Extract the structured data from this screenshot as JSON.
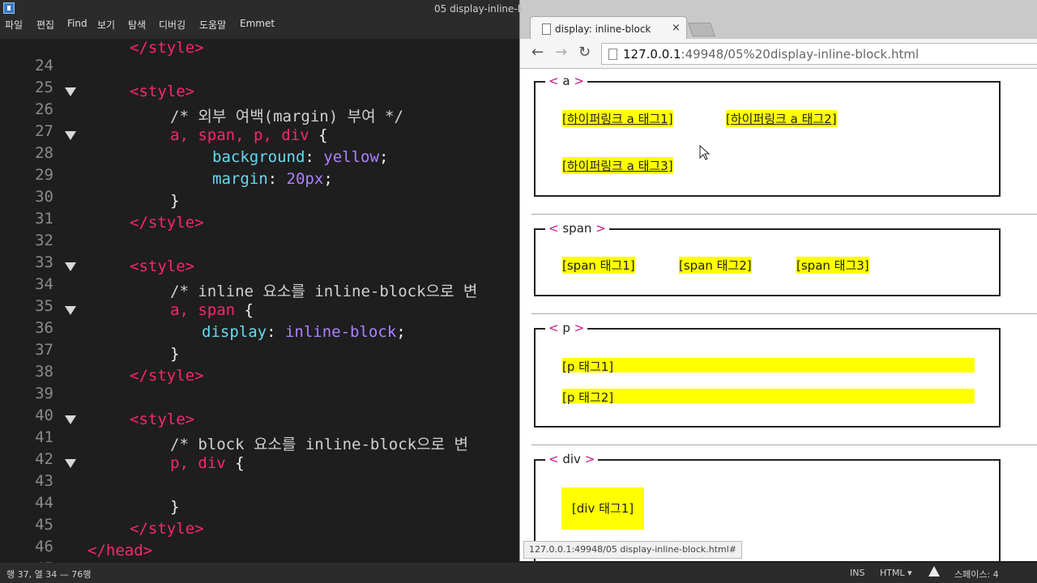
{
  "editor": {
    "menu": [
      "파일",
      "편집",
      "Find",
      "보기",
      "탐색",
      "디버깅",
      "도움말",
      "Emmet"
    ],
    "title": "05 display-inline-bl",
    "lines": [
      {
        "n": "24",
        "fold": false
      },
      {
        "n": "25",
        "fold": false
      },
      {
        "n": "26",
        "fold": true
      },
      {
        "n": "27",
        "fold": false
      },
      {
        "n": "28",
        "fold": true
      },
      {
        "n": "29",
        "fold": false
      },
      {
        "n": "30",
        "fold": false
      },
      {
        "n": "31",
        "fold": false
      },
      {
        "n": "32",
        "fold": false
      },
      {
        "n": "33",
        "fold": false
      },
      {
        "n": "34",
        "fold": true
      },
      {
        "n": "35",
        "fold": false
      },
      {
        "n": "36",
        "fold": true
      },
      {
        "n": "37",
        "fold": false
      },
      {
        "n": "38",
        "fold": false
      },
      {
        "n": "39",
        "fold": false
      },
      {
        "n": "40",
        "fold": false
      },
      {
        "n": "41",
        "fold": true
      },
      {
        "n": "42",
        "fold": false
      },
      {
        "n": "43",
        "fold": true
      },
      {
        "n": "44",
        "fold": false
      },
      {
        "n": "45",
        "fold": false
      },
      {
        "n": "46",
        "fold": false
      },
      {
        "n": "47",
        "fold": false
      }
    ],
    "code": {
      "l24": "</style>",
      "l26": "<style>",
      "l27": "/* 외부 여백(margin) 부여 */",
      "l28_sel": "a, span, p, div",
      "l28_brace": " {",
      "l29_prop": "background",
      "l29_val": "yellow",
      "l30_prop": "margin",
      "l30_val": "20px",
      "l31": "}",
      "l32": "</style>",
      "l34": "<style>",
      "l35": "/* inline 요소를 inline-block으로 변",
      "l36_sel": "a, span",
      "l36_brace": " {",
      "l37_prop": "display",
      "l37_val": "inline-block",
      "l38": "}",
      "l39": "</style>",
      "l41": "<style>",
      "l42": "/* block 요소를 inline-block으로 변",
      "l43_sel": "p, div",
      "l43_brace": " {",
      "l45": "}",
      "l46": "</style>",
      "l47": "</head>",
      "colon": ":",
      "semi": ";"
    },
    "status": {
      "position": "행 37, 열 34 — 76행",
      "ins": "INS",
      "mode": "HTML ▾",
      "spaces": "스페이스: 4"
    }
  },
  "browser": {
    "tab_title": "display: inline-block",
    "tab_close": "×",
    "url_host": "127.0.0.1",
    "url_rest": ":49948/05%20display-inline-block.html",
    "status_url": "127.0.0.1:49948/05 display-inline-block.html#",
    "sections": {
      "a": {
        "legend": "a",
        "items": [
          "[하이퍼링크 a 태그1]",
          "[하이퍼링크 a 태그2]",
          "[하이퍼링크 a 태그3]"
        ]
      },
      "span": {
        "legend": "span",
        "items": [
          "[span 태그1]",
          "[span 태그2]",
          "[span 태그3]"
        ]
      },
      "p": {
        "legend": "p",
        "items": [
          "[p 태그1]",
          "[p 태그2]"
        ]
      },
      "div": {
        "legend": "div",
        "items": [
          "[div 태그1]"
        ]
      }
    },
    "legend_open": "<",
    "legend_close": ">"
  },
  "colors": {
    "highlight": "#ffff00",
    "tag": "#f92672",
    "property": "#66d9ef",
    "value": "#ae81ff"
  }
}
